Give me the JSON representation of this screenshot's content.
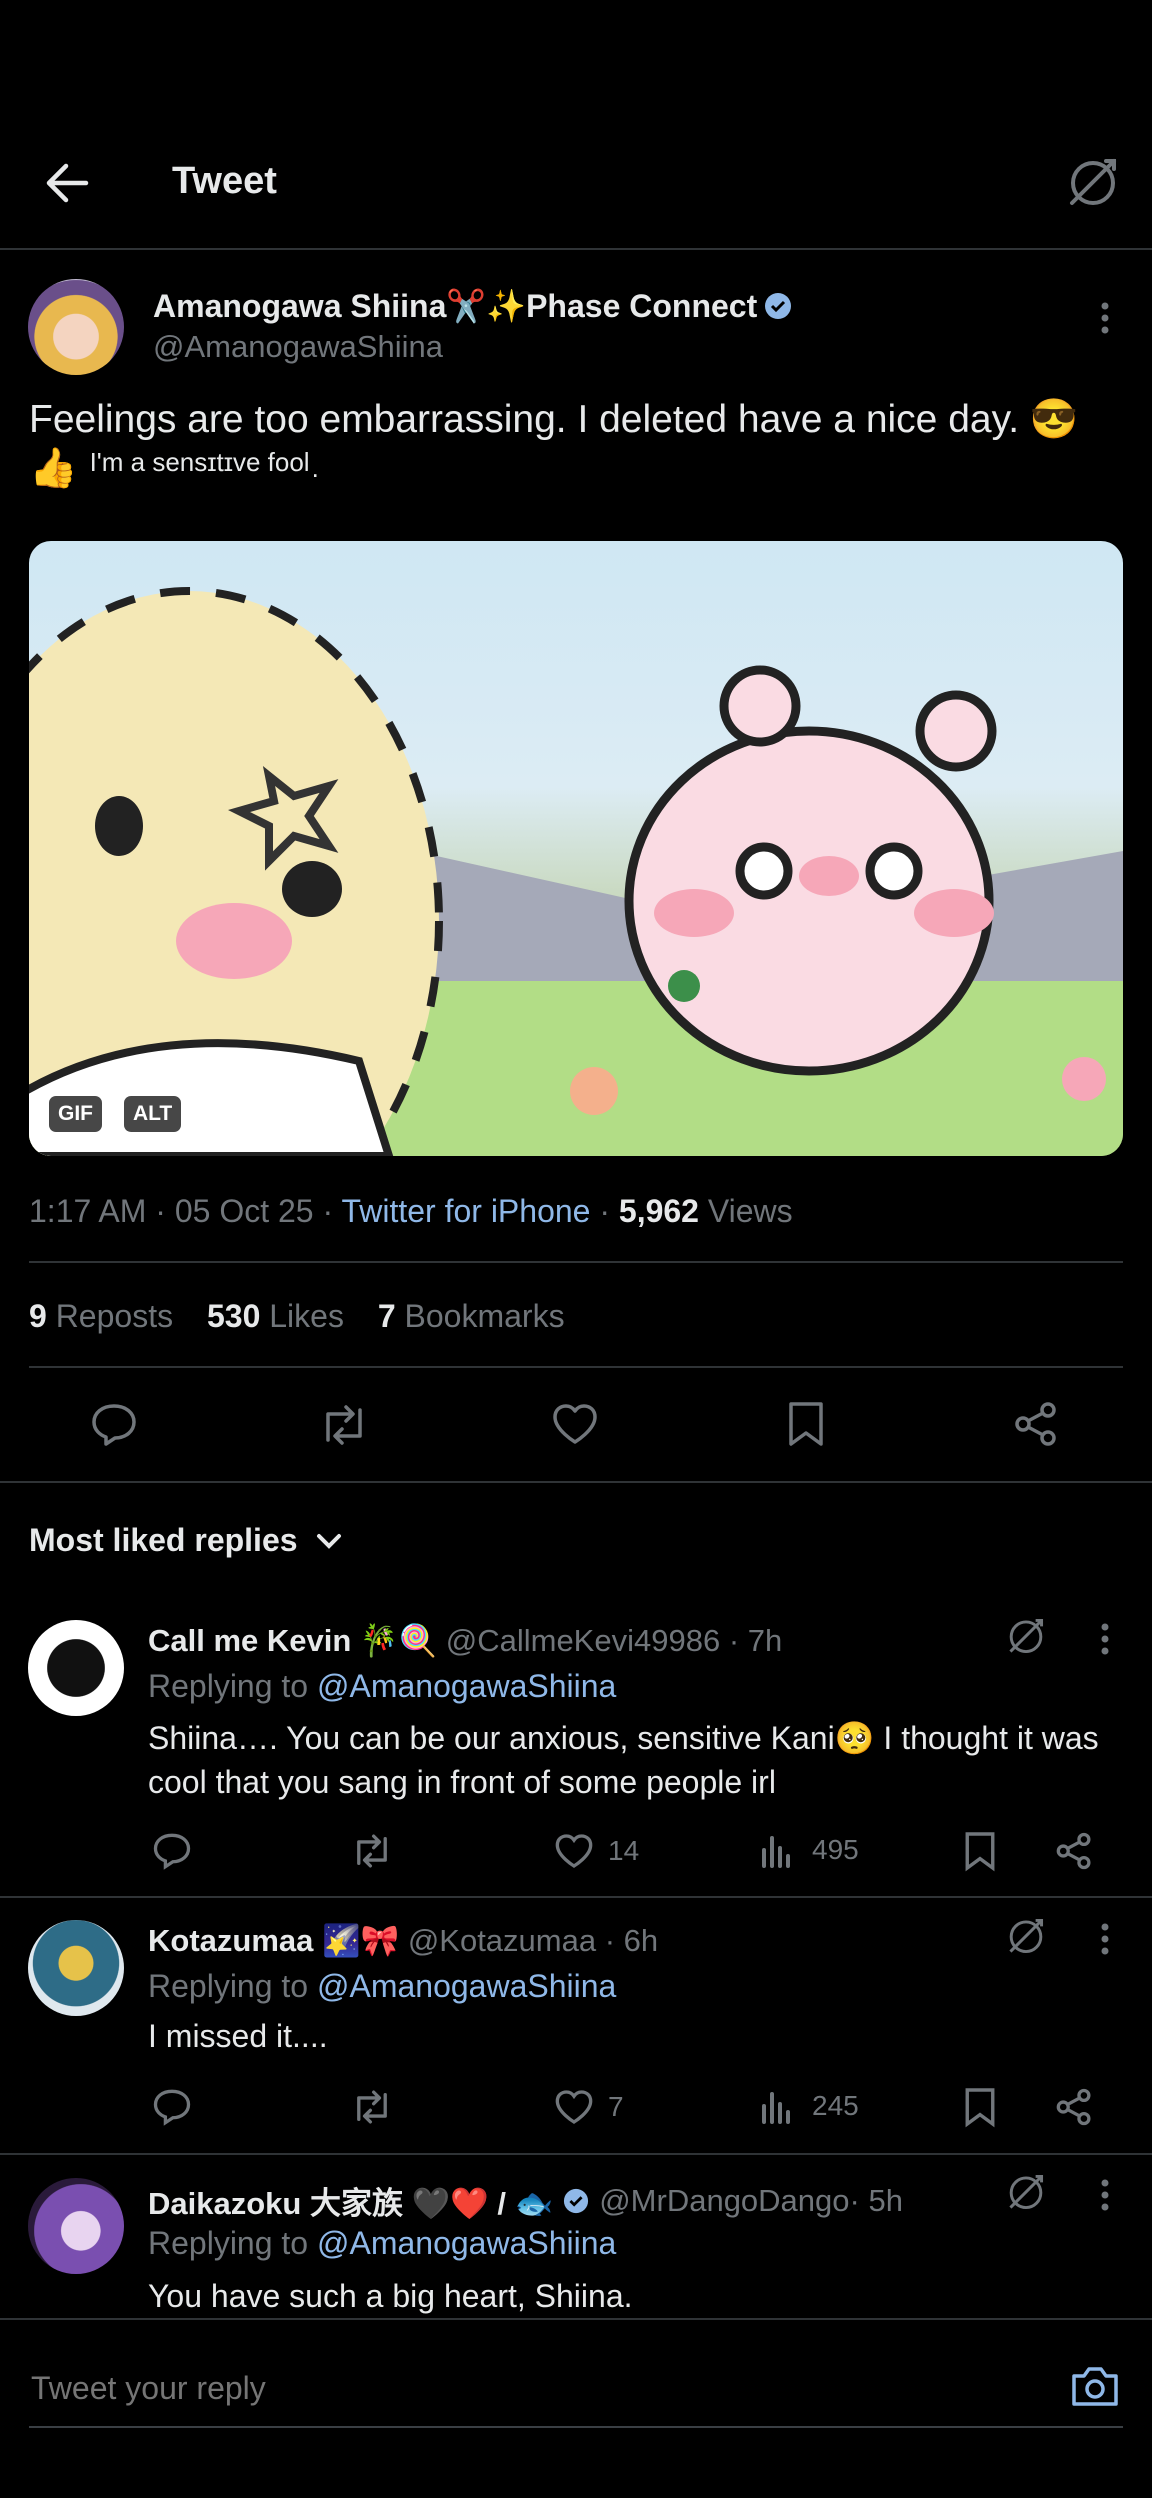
{
  "header": {
    "title": "Tweet"
  },
  "tweet": {
    "display_name": "Amanogawa Shiina✂️✨Phase Connect",
    "handle": "@AmanogawaShiina",
    "text_main": "Feelings are too embarrassing. I deleted have a nice day. 😎",
    "text_line2_emoji": "👍",
    "text_line2_small": "I'm a sensɪtɪve fool",
    "text_line2_end": ".",
    "media_badges": {
      "gif": "GIF",
      "alt": "ALT"
    },
    "meta": {
      "time": "1:17 AM",
      "sep1": " · ",
      "date": "05 Oct 25",
      "sep2": " · ",
      "source": "Twitter for iPhone",
      "sep3": " · ",
      "views_count": "5,962",
      "views_label": " Views"
    },
    "stats": {
      "reposts_count": "9",
      "reposts_label": " Reposts",
      "likes_count": "530",
      "likes_label": " Likes",
      "bookmarks_count": "7",
      "bookmarks_label": " Bookmarks"
    }
  },
  "replies_sort": {
    "label": "Most liked replies"
  },
  "replies": [
    {
      "name": "Call me Kevin 🎋🍭",
      "handle": "@CallmeKevi49986",
      "time": " · 7h",
      "replying_prefix": "Replying to ",
      "replying_to": "@AmanogawaShiina",
      "text": "Shiina…. You can be our anxious, sensitive Kani🥺 I thought it was cool that you sang in front of some people irl",
      "likes": "14",
      "views": "495"
    },
    {
      "name": "Kotazumaa 🌠🎀",
      "handle": "@Kotazumaa",
      "time": " · 6h",
      "replying_prefix": "Replying to ",
      "replying_to": "@AmanogawaShiina",
      "text": "I missed it....",
      "likes": "7",
      "views": "245"
    },
    {
      "name": "Daikazoku 大家族 🖤❤️ / 🐟",
      "handle": "@MrDangoDango",
      "time": " · 5h",
      "replying_prefix": "Replying to ",
      "replying_to": "@AmanogawaShiina",
      "text": "You have such a big heart, Shiina."
    }
  ],
  "composer": {
    "placeholder": "Tweet your reply"
  },
  "colors": {
    "background": "#000000",
    "text": "#e7e9ea",
    "muted": "#71767b",
    "link": "#8fb8e8",
    "verified": "#8fb8e8",
    "divider": "#2f3336"
  }
}
